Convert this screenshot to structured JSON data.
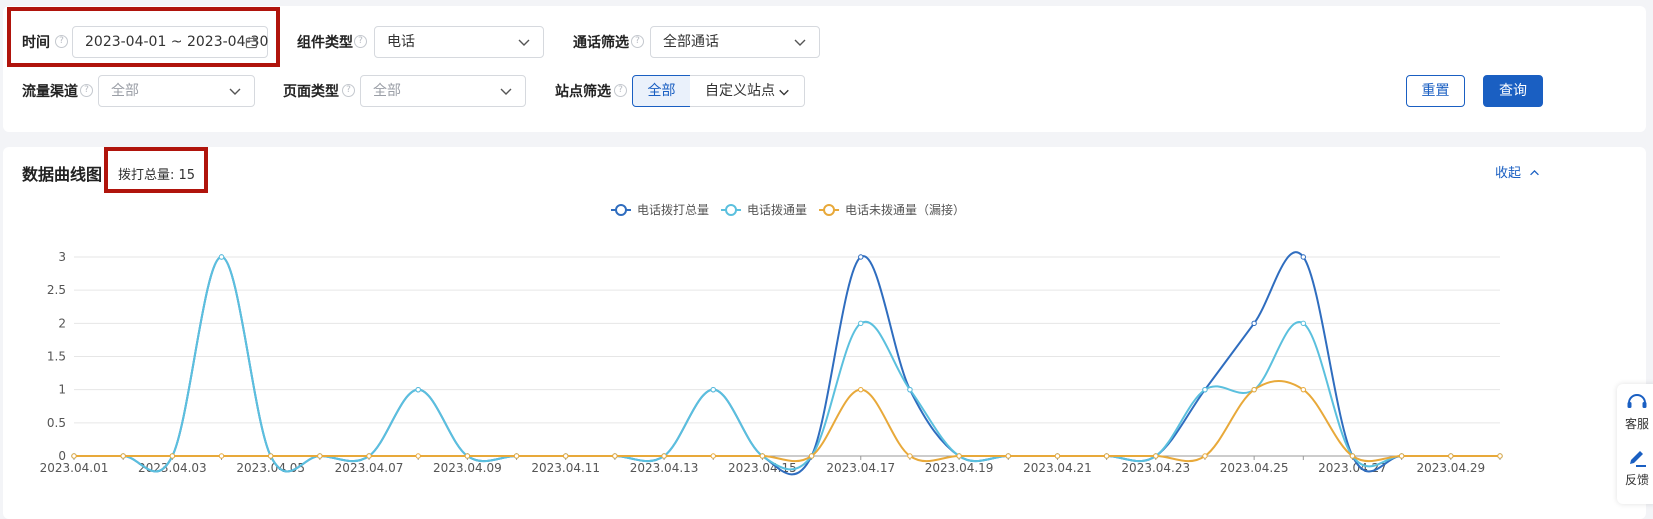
{
  "filters": {
    "time": {
      "label": "时间",
      "value": "2023-04-01 ~ 2023-04-30"
    },
    "component_type": {
      "label": "组件类型",
      "value": "电话"
    },
    "call_filter": {
      "label": "通话筛选",
      "value": "全部通话"
    },
    "traffic_channel": {
      "label": "流量渠道",
      "placeholder": "全部"
    },
    "page_type": {
      "label": "页面类型",
      "placeholder": "全部"
    },
    "site_filter": {
      "label": "站点筛选",
      "options": [
        "全部",
        "自定义站点"
      ],
      "selected": "全部"
    },
    "help_glyph": "?",
    "reset_label": "重置",
    "query_label": "查询"
  },
  "chart_panel": {
    "title": "数据曲线图",
    "total_badge": "拨打总量: 15",
    "collapse_label": "收起"
  },
  "side_widget": {
    "service_label": "客服",
    "feedback_label": "反馈"
  },
  "colors": {
    "primary": "#1a5fc2",
    "highlight_frame": "#b0140c",
    "series1": "#2f6dbf",
    "series2": "#5bc0de",
    "series3": "#e8a93a"
  },
  "chart_data": {
    "type": "line",
    "smooth": true,
    "title": "",
    "xlabel": "",
    "ylabel": "",
    "ylim": [
      0,
      3
    ],
    "yticks": [
      0,
      0.5,
      1,
      1.5,
      2,
      2.5,
      3
    ],
    "grid": true,
    "legend_position": "top-center",
    "x": [
      "2023.04.01",
      "2023.04.02",
      "2023.04.03",
      "2023.04.04",
      "2023.04.05",
      "2023.04.06",
      "2023.04.07",
      "2023.04.08",
      "2023.04.09",
      "2023.04.10",
      "2023.04.11",
      "2023.04.12",
      "2023.04.13",
      "2023.04.14",
      "2023.04.15",
      "2023.04.16",
      "2023.04.17",
      "2023.04.18",
      "2023.04.19",
      "2023.04.20",
      "2023.04.21",
      "2023.04.22",
      "2023.04.23",
      "2023.04.24",
      "2023.04.25",
      "2023.04.26",
      "2023.04.27",
      "2023.04.28",
      "2023.04.29",
      "2023.04.30"
    ],
    "xticks_shown": [
      "2023.04.01",
      "2023.04.03",
      "2023.04.05",
      "2023.04.07",
      "2023.04.09",
      "2023.04.11",
      "2023.04.13",
      "2023.04.15",
      "2023.04.17",
      "2023.04.19",
      "2023.04.21",
      "2023.04.23",
      "2023.04.25",
      "2023.04.27",
      "2023.04.29"
    ],
    "series": [
      {
        "name": "电话拨打总量",
        "color": "#2f6dbf",
        "values": [
          0,
          0,
          0,
          3,
          0,
          0,
          0,
          1,
          0,
          0,
          0,
          0,
          0,
          1,
          0,
          0,
          3,
          1,
          0,
          0,
          0,
          0,
          0,
          1,
          2,
          3,
          0,
          0,
          0,
          0
        ]
      },
      {
        "name": "电话拨通量",
        "color": "#5bc0de",
        "values": [
          0,
          0,
          0,
          3,
          0,
          0,
          0,
          1,
          0,
          0,
          0,
          0,
          0,
          1,
          0,
          0,
          2,
          1,
          0,
          0,
          0,
          0,
          0,
          1,
          1,
          2,
          0,
          0,
          0,
          0
        ]
      },
      {
        "name": "电话未拨通量（漏接）",
        "color": "#e8a93a",
        "values": [
          0,
          0,
          0,
          0,
          0,
          0,
          0,
          0,
          0,
          0,
          0,
          0,
          0,
          0,
          0,
          0,
          1,
          0,
          0,
          0,
          0,
          0,
          0,
          0,
          1,
          1,
          0,
          0,
          0,
          0
        ]
      }
    ]
  }
}
